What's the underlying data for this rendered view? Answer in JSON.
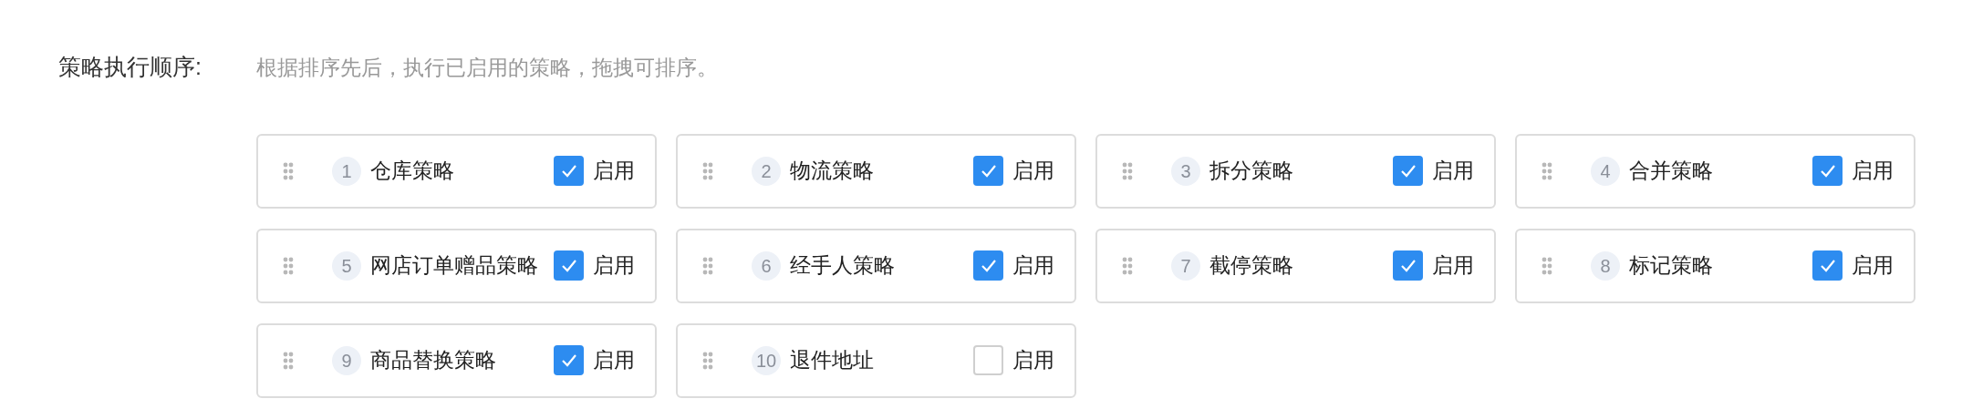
{
  "label": "策略执行顺序:",
  "hint": "根据排序先后，执行已启用的策略，拖拽可排序。",
  "strategies": [
    {
      "index": "1",
      "name": "仓库策略",
      "enable_label": "启用",
      "checked": true
    },
    {
      "index": "2",
      "name": "物流策略",
      "enable_label": "启用",
      "checked": true
    },
    {
      "index": "3",
      "name": "拆分策略",
      "enable_label": "启用",
      "checked": true
    },
    {
      "index": "4",
      "name": "合并策略",
      "enable_label": "启用",
      "checked": true
    },
    {
      "index": "5",
      "name": "网店订单赠品策略",
      "enable_label": "启用",
      "checked": true
    },
    {
      "index": "6",
      "name": "经手人策略",
      "enable_label": "启用",
      "checked": true
    },
    {
      "index": "7",
      "name": "截停策略",
      "enable_label": "启用",
      "checked": true
    },
    {
      "index": "8",
      "name": "标记策略",
      "enable_label": "启用",
      "checked": true
    },
    {
      "index": "9",
      "name": "商品替换策略",
      "enable_label": "启用",
      "checked": true
    },
    {
      "index": "10",
      "name": "退件地址",
      "enable_label": "启用",
      "checked": false
    }
  ]
}
